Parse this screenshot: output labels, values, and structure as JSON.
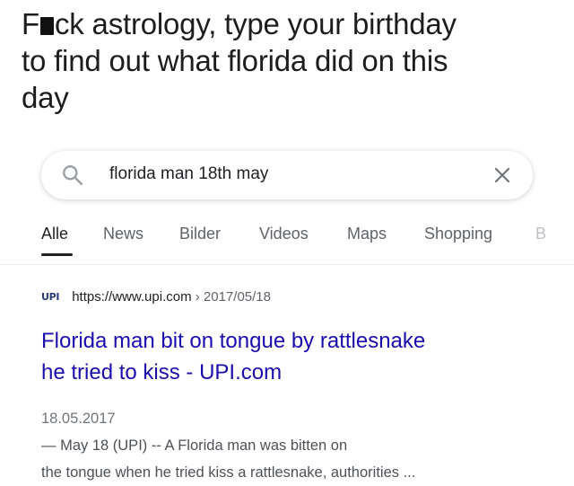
{
  "caption": {
    "line1_prefix": "F",
    "line1_suffix": "ck astrology, type your birthday",
    "line2": "to find out what florida did on this",
    "line3": "day"
  },
  "search": {
    "query": "florida man 18th may"
  },
  "tabs": [
    {
      "label": "Alle",
      "active": true
    },
    {
      "label": "News",
      "active": false
    },
    {
      "label": "Bilder",
      "active": false
    },
    {
      "label": "Videos",
      "active": false
    },
    {
      "label": "Maps",
      "active": false
    },
    {
      "label": "Shopping",
      "active": false
    },
    {
      "label": "B",
      "active": false
    }
  ],
  "result": {
    "favicon_text": "UPI",
    "url": "https://www.upi.com",
    "breadcrumb": " › 2017/05/18",
    "title_line1": "Florida man bit on tongue by rattlesnake",
    "title_line2": "he tried to kiss - UPI.com",
    "date": "18.05.2017",
    "snippet_line1_rest": " — May 18 (UPI) -- A Florida man was bitten on",
    "snippet_line2": "the tongue when he tried kiss a rattlesnake, authorities ..."
  },
  "colors": {
    "link": "#1a0dab",
    "snippet": "#4d5156",
    "tab_inactive": "#5f6368",
    "favicon": "#2b3a7a"
  },
  "icons": {
    "search": "search-icon",
    "clear": "close-icon"
  }
}
